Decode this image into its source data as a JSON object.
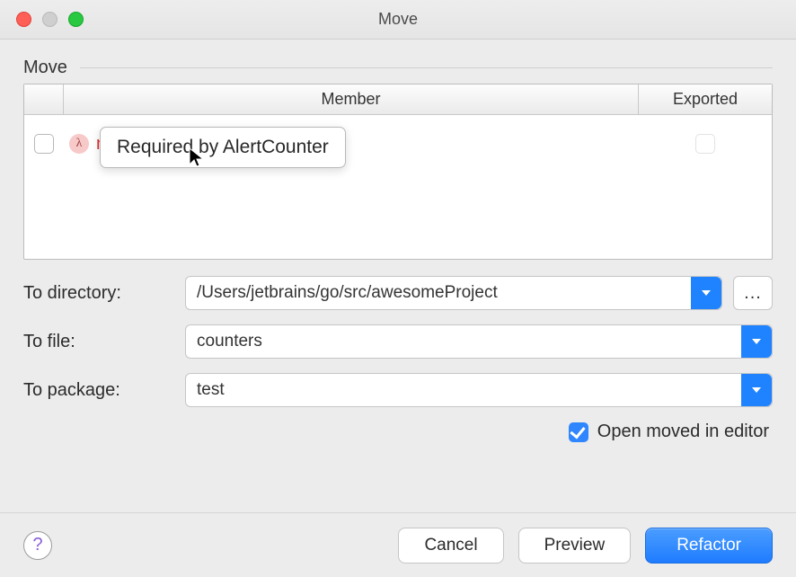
{
  "window": {
    "title": "Move"
  },
  "section": {
    "title": "Move"
  },
  "table": {
    "columns": {
      "member": "Member",
      "exported": "Exported"
    },
    "rows": [
      {
        "icon": "lambda-icon",
        "name": "main",
        "name_color": "red",
        "checked": false,
        "exported_checked": false
      }
    ],
    "tooltip": "Required by AlertCounter"
  },
  "form": {
    "to_directory": {
      "label": "To directory:",
      "value": "/Users/jetbrains/go/src/awesomeProject"
    },
    "to_file": {
      "label": "To file:",
      "value": "counters"
    },
    "to_package": {
      "label": "To package:",
      "value": "test"
    }
  },
  "options": {
    "open_in_editor": {
      "label": "Open moved in editor",
      "checked": true
    }
  },
  "buttons": {
    "cancel": "Cancel",
    "preview": "Preview",
    "refactor": "Refactor",
    "browse": "...",
    "help": "?"
  },
  "icons": {
    "lambda_glyph": "λ"
  }
}
